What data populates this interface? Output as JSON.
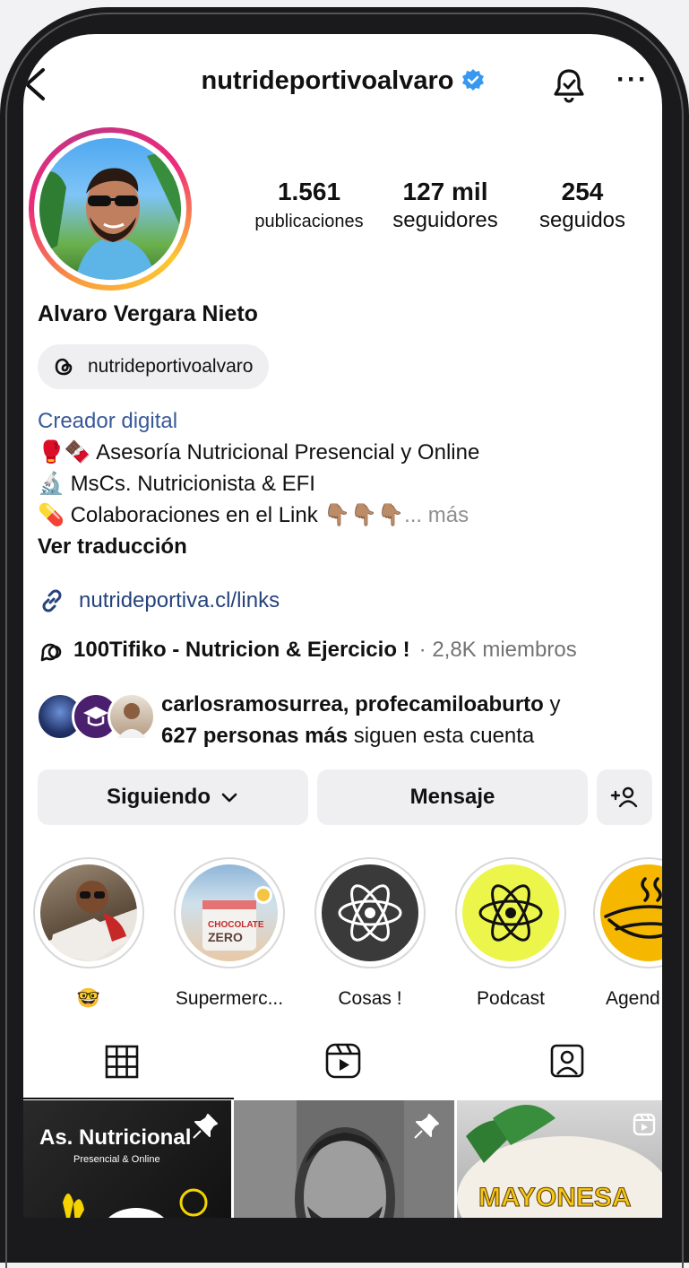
{
  "profile": {
    "username": "nutrideportivoalvaro",
    "display_name": "Alvaro Vergara Nieto",
    "threads_handle": "nutrideportivoalvaro",
    "category": "Creador digital",
    "bio_lines": [
      {
        "emoji": "🥊🍫",
        "text": "Asesoría Nutricional Presencial y Online"
      },
      {
        "emoji": "🔬",
        "text": "MsCs. Nutricionista & EFI"
      },
      {
        "emoji": "💊",
        "text": "Colaboraciones en el Link 👇🏽👇🏽👇🏽"
      }
    ],
    "bio_more": "... más",
    "translate_label": "Ver traducción",
    "link": "nutrideportiva.cl/links",
    "community_name": "100Tifiko - Nutricion & Ejercicio !",
    "community_members": "· 2,8K miembros"
  },
  "stats": [
    {
      "value": "1.561",
      "label": "publicaciones"
    },
    {
      "value": "127 mil",
      "label": "seguidores"
    },
    {
      "value": "254",
      "label": "seguidos"
    }
  ],
  "followed_by": {
    "names": "carlosramosurrea, profecamiloaburto",
    "joiner": " y",
    "others": "627 personas más",
    "suffix": " siguen esta cuenta"
  },
  "buttons": {
    "following": "Siguiendo",
    "message": "Mensaje"
  },
  "highlights": [
    {
      "label": "🤓"
    },
    {
      "label": "Supermerc..."
    },
    {
      "label": "Cosas !"
    },
    {
      "label": "Podcast"
    },
    {
      "label": "Agend"
    }
  ],
  "posts": [
    {
      "title": "As. Nutricional",
      "subtitle": "Presencial & Online"
    },
    {
      "title": ""
    },
    {
      "title": "MAYONESA"
    }
  ],
  "colors": {
    "verified": "#3897f0",
    "link": "#25437c",
    "category": "#385998"
  },
  "icons": [
    "back-chevron-icon",
    "verified-badge-icon",
    "bell-icon",
    "more-icon",
    "threads-icon",
    "link-icon",
    "community-icon",
    "chevron-down-icon",
    "add-person-icon",
    "grid-icon",
    "reels-icon",
    "tagged-icon",
    "pin-icon",
    "reel-badge-icon"
  ]
}
